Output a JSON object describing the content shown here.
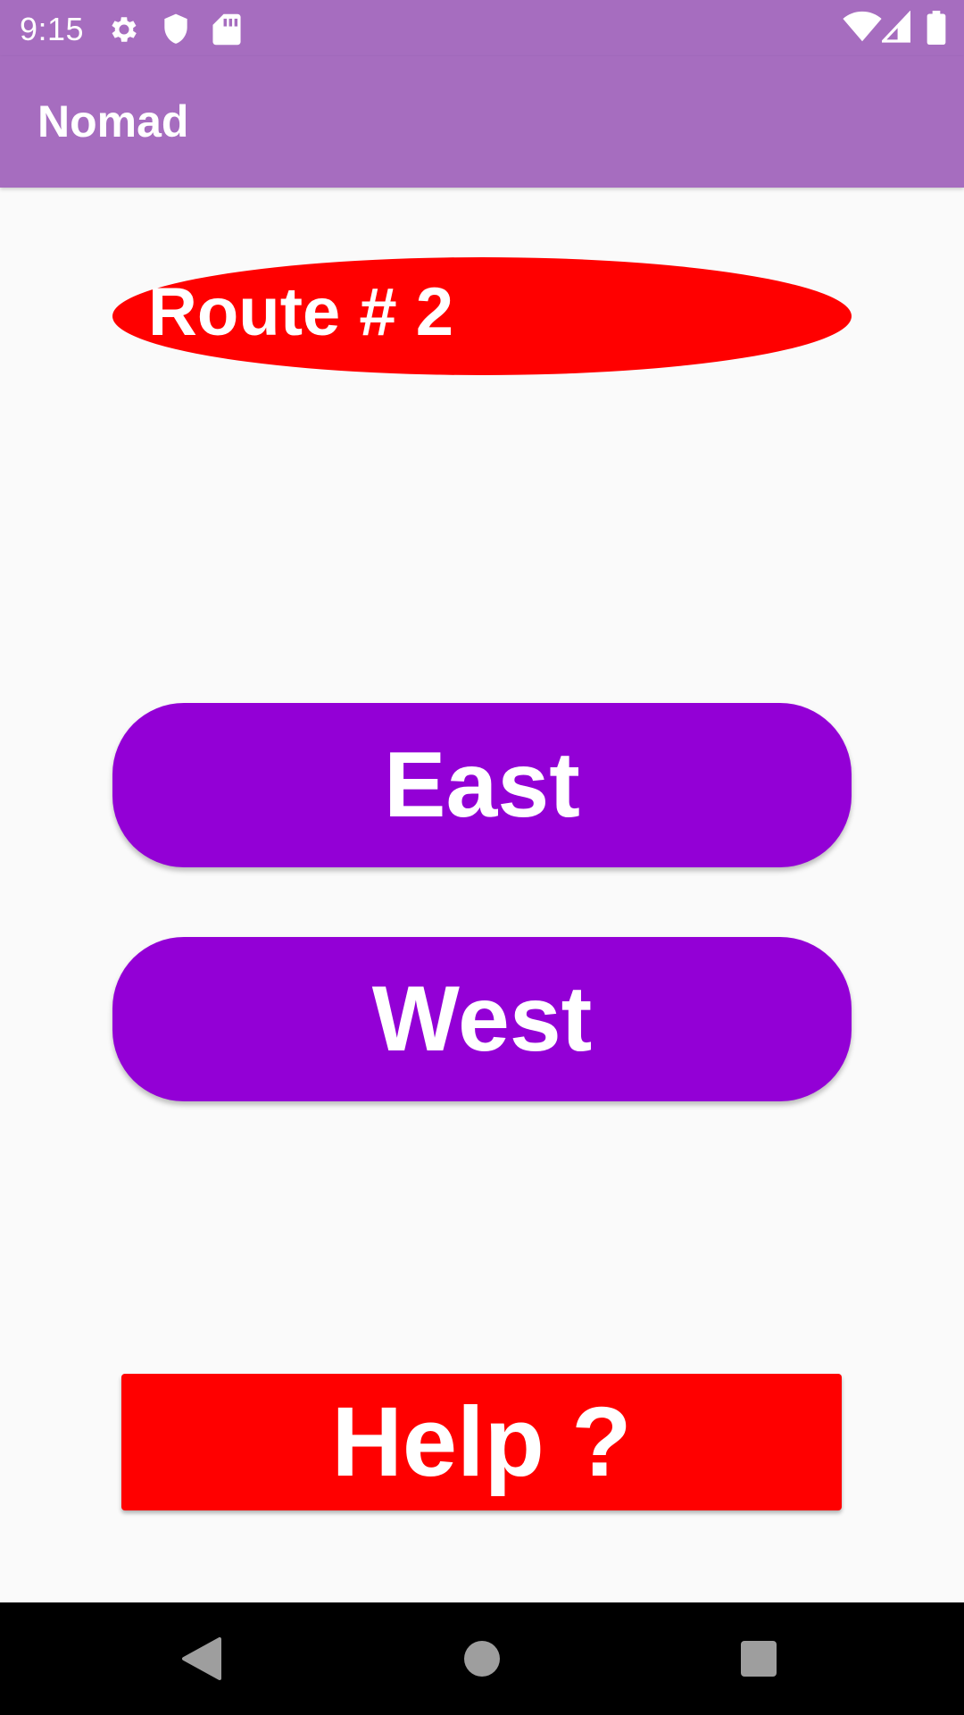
{
  "status_bar": {
    "time": "9:15",
    "icons": [
      "settings-icon",
      "shield-icon",
      "sd-card-icon",
      "wifi-icon",
      "signal-icon",
      "battery-icon"
    ]
  },
  "app_bar": {
    "title": "Nomad"
  },
  "route": {
    "label": "Route # 2"
  },
  "directions": {
    "east_label": "East",
    "west_label": "West"
  },
  "help": {
    "label": "Help ?"
  },
  "nav_bar": {
    "icons": [
      "back-icon",
      "home-icon",
      "recents-icon"
    ]
  },
  "colors": {
    "app_bar": "#a66dbf",
    "button_purple": "#9300d6",
    "accent_red": "#ff0000",
    "background": "#fafafa"
  }
}
